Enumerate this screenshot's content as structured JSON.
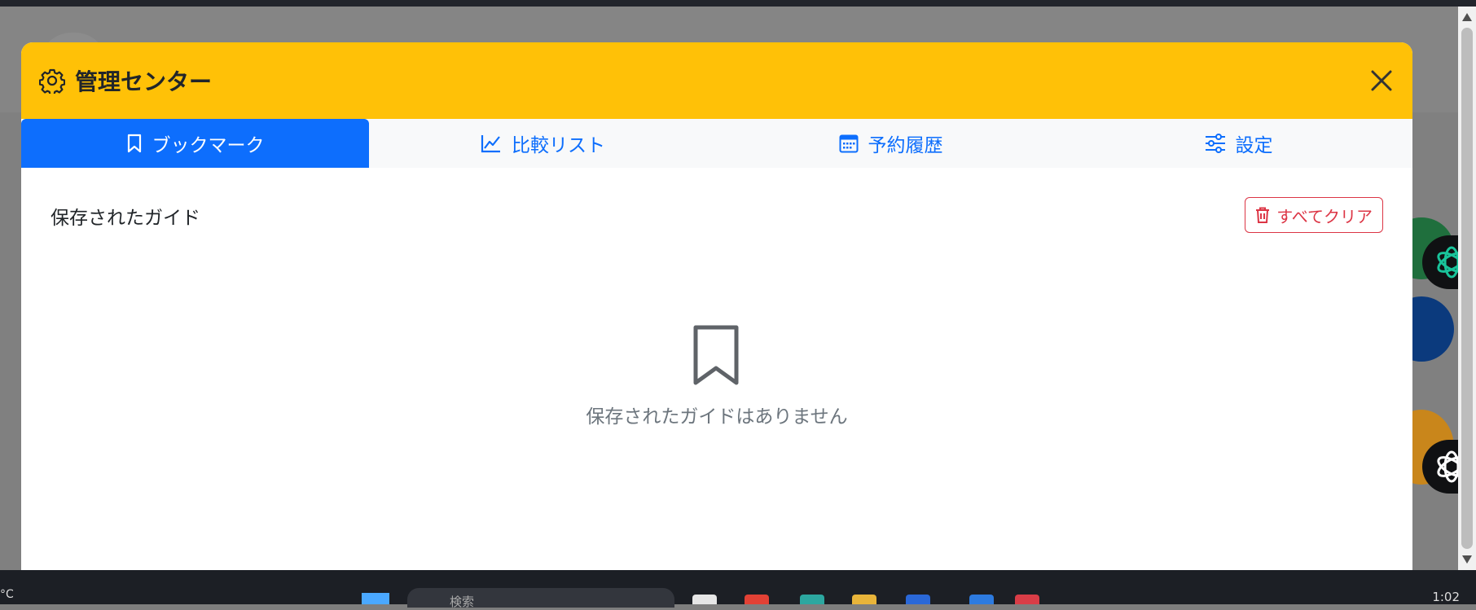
{
  "modal": {
    "title": "管理センター",
    "tabs": [
      {
        "label": "ブックマーク",
        "icon": "bookmark-icon",
        "active": true
      },
      {
        "label": "比較リスト",
        "icon": "chart-line-icon",
        "active": false
      },
      {
        "label": "予約履歴",
        "icon": "calendar-icon",
        "active": false
      },
      {
        "label": "設定",
        "icon": "sliders-icon",
        "active": false
      }
    ],
    "section_title": "保存されたガイド",
    "clear_all_label": "すべてクリア",
    "empty_message": "保存されたガイドはありません"
  },
  "taskbar": {
    "temperature": "°C",
    "search_placeholder": "検索",
    "clock": "1:02"
  },
  "colors": {
    "header_bg": "#ffc107",
    "accent": "#0d6efd",
    "danger": "#dc3545",
    "muted_text": "#6c757d"
  }
}
